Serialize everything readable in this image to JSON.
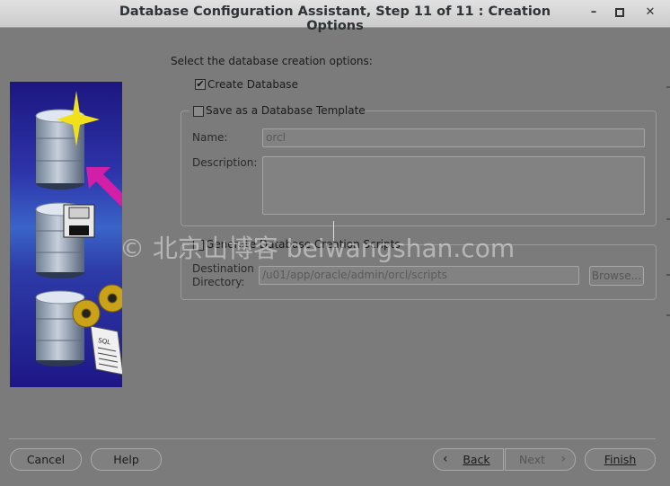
{
  "window": {
    "title": "Database Configuration Assistant, Step 11 of 11 : Creation Options",
    "minimize_icon": "minimize-icon",
    "maximize_icon": "maximize-icon",
    "close_icon": "close-icon"
  },
  "main": {
    "instruction": "Select the database creation options:",
    "create_database": {
      "label": "Create Database",
      "checked": true
    },
    "save_template": {
      "label": "Save as a Database Template",
      "checked": false,
      "name_label": "Name:",
      "name_value": "orcl",
      "description_label": "Description:",
      "description_value": ""
    },
    "scripts": {
      "label": "Generate Database Creation Scripts",
      "checked": false,
      "dest_label_line1": "Destination",
      "dest_label_line2": "Directory:",
      "dest_value": "/u01/app/oracle/admin/orcl/scripts",
      "browse_label": "Browse..."
    }
  },
  "sidebar_image": {
    "label": "SQL"
  },
  "watermark": "© 北京山博客 beiwangshan.com",
  "footer": {
    "cancel": "Cancel",
    "help": "Help",
    "back": "Back",
    "next": "Next",
    "finish": "Finish"
  },
  "colors": {
    "background": "#7b7b7b",
    "titlebar": "#d6d6d6",
    "image_top": "#1c1680",
    "image_mid": "#3a64c8",
    "arrow": "#d21fa8",
    "star": "#f1e11a",
    "gear": "#c9a21a"
  }
}
